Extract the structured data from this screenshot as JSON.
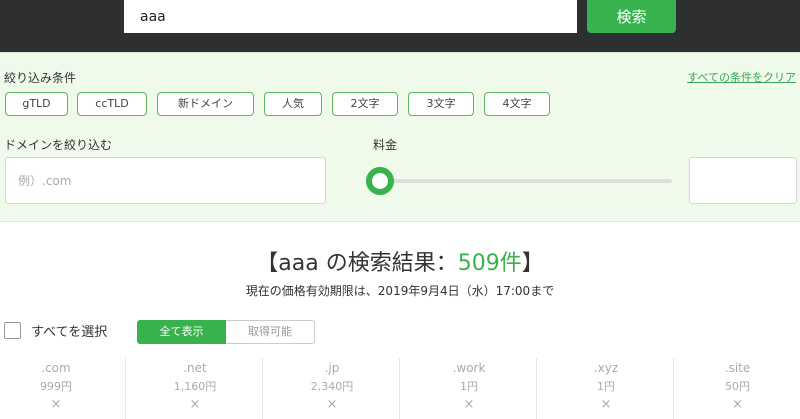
{
  "search": {
    "value": "aaa",
    "button_label": "検索"
  },
  "filters": {
    "title": "絞り込み条件",
    "clear_label": "すべての条件をクリア",
    "chips": [
      "gTLD",
      "ccTLD",
      "新ドメイン",
      "人気",
      "2文字",
      "3文字",
      "4文字"
    ],
    "domain_label": "ドメインを絞り込む",
    "domain_placeholder": "例）.com",
    "price_label": "料金",
    "price_value": "",
    "accent_color": "#37b24d"
  },
  "results": {
    "open_bracket": "【",
    "query": "aaa",
    "mid": " の検索結果：",
    "count": "509件",
    "close_bracket": "】",
    "price_note": "現在の価格有効期限は、2019年9月4日（水）17:00まで"
  },
  "list_controls": {
    "select_all_label": "すべてを選択",
    "toggle_on": "全て表示",
    "toggle_off": "取得可能"
  },
  "tlds": [
    {
      "name": ".com",
      "price": "999円",
      "status": "×"
    },
    {
      "name": ".net",
      "price": "1,160円",
      "status": "×"
    },
    {
      "name": ".jp",
      "price": "2,340円",
      "status": "×"
    },
    {
      "name": ".work",
      "price": "1円",
      "status": "×"
    },
    {
      "name": ".xyz",
      "price": "1円",
      "status": "×"
    },
    {
      "name": ".site",
      "price": "50円",
      "status": "×"
    }
  ]
}
